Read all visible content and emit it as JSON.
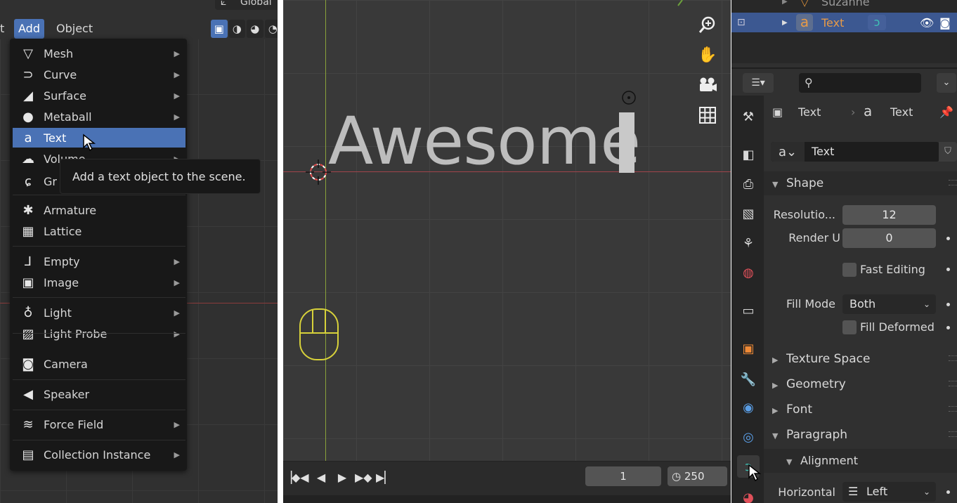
{
  "left": {
    "menubar": {
      "partial_item": "t",
      "add": "Add",
      "object": "Object"
    },
    "global_label": "Global",
    "menu_items": [
      {
        "label": "Mesh",
        "icon": "mesh-icon",
        "glyph": "▽",
        "submenu": true
      },
      {
        "label": "Curve",
        "icon": "curve-icon",
        "glyph": "⊃",
        "submenu": true
      },
      {
        "label": "Surface",
        "icon": "surface-icon",
        "glyph": "◢",
        "submenu": true
      },
      {
        "label": "Metaball",
        "icon": "metaball-icon",
        "glyph": "●",
        "submenu": true
      },
      {
        "label": "Text",
        "icon": "text-icon",
        "glyph": "a",
        "submenu": false
      },
      {
        "label": "Volume",
        "icon": "volume-icon",
        "glyph": "☁",
        "submenu": true
      },
      {
        "label": "Gr",
        "icon": "grease-pencil-icon",
        "glyph": "ɕ",
        "submenu": false
      },
      {
        "label": "Armature",
        "icon": "armature-icon",
        "glyph": "✱",
        "submenu": false
      },
      {
        "label": "Lattice",
        "icon": "lattice-icon",
        "glyph": "▦",
        "submenu": false
      },
      {
        "label": "Empty",
        "icon": "empty-icon",
        "glyph": "⅃",
        "submenu": true
      },
      {
        "label": "Image",
        "icon": "image-icon",
        "glyph": "▣",
        "submenu": true
      },
      {
        "label": "Light",
        "icon": "light-icon",
        "glyph": "♁",
        "submenu": true
      },
      {
        "label": "Light Probe",
        "icon": "light-probe-icon",
        "glyph": "▨",
        "submenu": true
      },
      {
        "label": "Camera",
        "icon": "camera-icon",
        "glyph": "◙",
        "submenu": false
      },
      {
        "label": "Speaker",
        "icon": "speaker-icon",
        "glyph": "◀",
        "submenu": false
      },
      {
        "label": "Force Field",
        "icon": "force-field-icon",
        "glyph": "≋",
        "submenu": true
      },
      {
        "label": "Collection Instance",
        "icon": "collection-instance-icon",
        "glyph": "▤",
        "submenu": true
      }
    ],
    "highlighted_item": "Text",
    "tooltip": "Add a text object to the scene."
  },
  "viewport": {
    "text_object": "Awesome",
    "frame_current": "1",
    "frame_end": "250"
  },
  "right": {
    "outliner": {
      "row_above": "Suzanne",
      "row_selected": "Text"
    },
    "breadcrumb": {
      "object": "Text",
      "data": "Text"
    },
    "datablock_name": "Text",
    "sections": {
      "shape": "Shape",
      "texture_space": "Texture Space",
      "geometry": "Geometry",
      "font": "Font",
      "paragraph": "Paragraph",
      "alignment": "Alignment"
    },
    "shape": {
      "resolution_label": "Resolutio...",
      "resolution_value": "12",
      "render_u_label": "Render U",
      "render_u_value": "0",
      "fast_editing_label": "Fast Editing",
      "fill_mode_label": "Fill Mode",
      "fill_mode_value": "Both",
      "fill_deformed_label": "Fill Deformed"
    },
    "alignment": {
      "horizontal_label": "Horizontal",
      "horizontal_value": "Left"
    }
  },
  "colors": {
    "accent": "#4a72b5",
    "menu_bg": "#181818",
    "panel_bg": "#303030",
    "text_obj": "#bdbdbd",
    "x_axis": "#a0454c",
    "y_axis": "#8aa23a"
  }
}
